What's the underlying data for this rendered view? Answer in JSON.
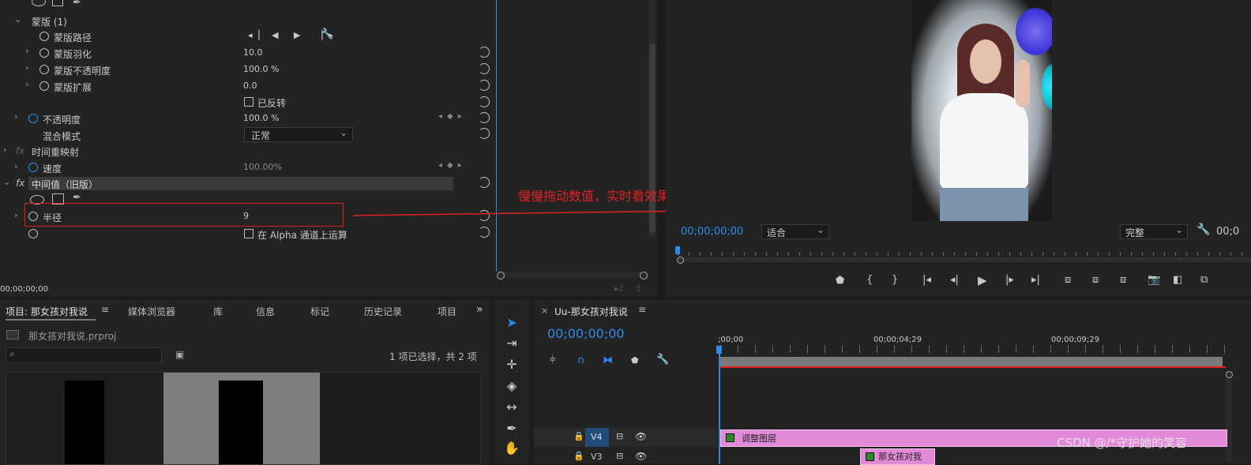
{
  "effects": {
    "mask_header": "蒙版 (1)",
    "mask_path": "蒙版路径",
    "mask_feather": "蒙版羽化",
    "mask_feather_value": "10.0",
    "mask_opacity": "蒙版不透明度",
    "mask_opacity_value": "100.0 %",
    "mask_expand": "蒙版扩展",
    "mask_expand_value": "0.0",
    "inverted": "已反转",
    "opacity": "不透明度",
    "opacity_value": "100.0 %",
    "blend_mode": "混合模式",
    "blend_mode_value": "正常",
    "time_remap": "时间重映射",
    "speed": "速度",
    "speed_value": "100.00%",
    "median_header": "中间值（旧版）",
    "radius": "半径",
    "radius_value": "9",
    "alpha_checkbox": "在 Alpha 通道上运算",
    "timecode": "00;00;00;00"
  },
  "annotation": {
    "text": "慢慢拖动数值，实时看效果",
    "color": "#e02020"
  },
  "program": {
    "timecode": "00;00;00;00",
    "zoom": "适合",
    "quality": "完整",
    "timecode_right": "00;0"
  },
  "project": {
    "tabs": [
      "项目: 那女孩对我说",
      "媒体浏览器",
      "库",
      "信息",
      "标记",
      "历史记录",
      "项目"
    ],
    "file": "那女孩对我说.prproj",
    "selection_info": "1 项已选择，共 2 项"
  },
  "timeline": {
    "sequence": "Uu-那女孩对我说",
    "timecode": "00;00;00;00",
    "ruler": [
      ";00;00",
      "00;00;04;29",
      "00;00;09;29"
    ],
    "tracks": [
      "V4",
      "V3"
    ],
    "clip_adjust": "调整图层",
    "clip_video": "那女孩对我"
  },
  "watermark": "CSDN @/*守护她的笑容",
  "colors": {
    "accent": "#2d8ceb",
    "clip_pink": "#e28ad8"
  }
}
